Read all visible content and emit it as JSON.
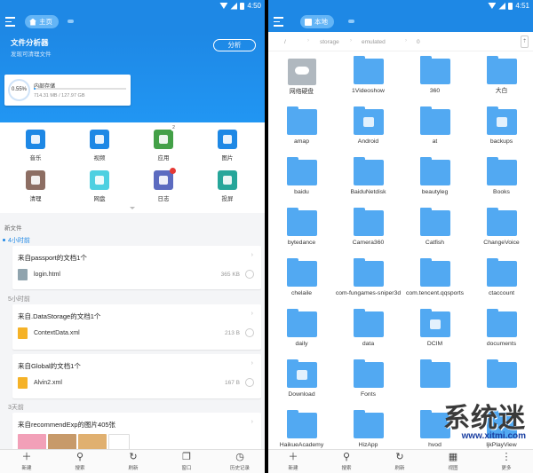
{
  "left": {
    "status": {
      "time": "4:50"
    },
    "toolbar": {
      "tab": "主页"
    },
    "analyzer": {
      "title": "文件分析器",
      "subtitle": "发现可清理文件",
      "analyze_button": "分析"
    },
    "storage": {
      "percent": "0.55%",
      "name": "内部存储",
      "size": "714.31 MB / 127.97 GB",
      "used_fraction": 0.0055
    },
    "categories": [
      {
        "label": "音乐",
        "color": "#1e88e5",
        "icon": "music-icon"
      },
      {
        "label": "视频",
        "color": "#1e88e5",
        "icon": "video-icon"
      },
      {
        "label": "应用",
        "color": "#43a047",
        "icon": "android-icon",
        "badge": "2"
      },
      {
        "label": "图片",
        "color": "#1e88e5",
        "icon": "image-icon"
      },
      {
        "label": "清理",
        "color": "#8d6e63",
        "icon": "broom-icon"
      },
      {
        "label": "网盘",
        "color": "#4dd0e1",
        "icon": "cloud-icon"
      },
      {
        "label": "日志",
        "color": "#5c6bc0",
        "icon": "log-icon",
        "dot": true
      },
      {
        "label": "投屏",
        "color": "#26a69a",
        "icon": "cast-icon"
      }
    ],
    "recent": {
      "header": "新文件",
      "time_labels": [
        "4小时前",
        "5小时前",
        "3天前"
      ],
      "cards": [
        {
          "title": "来自passport的文档1个",
          "file": "login.html",
          "size": "365 KB",
          "type": "html"
        },
        {
          "title": "来自.DataStorage的文档1个",
          "file": "ContextData.xml",
          "size": "213 B",
          "type": "xml"
        },
        {
          "title": "来自Global的文档1个",
          "file": "Alvin2.xml",
          "size": "167 B",
          "type": "xml"
        },
        {
          "title": "来自recommendExp的图片405张"
        }
      ]
    },
    "bottom_nav": [
      {
        "label": "新建",
        "glyph": "＋",
        "icon": "plus-icon"
      },
      {
        "label": "搜索",
        "glyph": "⚲",
        "icon": "search-icon"
      },
      {
        "label": "刷新",
        "glyph": "↻",
        "icon": "refresh-icon"
      },
      {
        "label": "窗口",
        "glyph": "❐",
        "icon": "windows-icon"
      },
      {
        "label": "历史记录",
        "glyph": "◷",
        "icon": "history-icon"
      }
    ]
  },
  "right": {
    "status": {
      "time": "4:51"
    },
    "toolbar": {
      "tab": "本地"
    },
    "path": [
      "/",
      "storage",
      "emulated",
      "0"
    ],
    "items": [
      {
        "label": "网络硬盘",
        "kind": "cloud"
      },
      {
        "label": "1Videoshow"
      },
      {
        "label": "360"
      },
      {
        "label": "大白"
      },
      {
        "label": "amap"
      },
      {
        "label": "Android",
        "glyph": true
      },
      {
        "label": "at"
      },
      {
        "label": "backups",
        "glyph": true
      },
      {
        "label": "baidu"
      },
      {
        "label": "BaiduNetdisk"
      },
      {
        "label": "beautyleg"
      },
      {
        "label": "Books"
      },
      {
        "label": "bytedance"
      },
      {
        "label": "Camera360"
      },
      {
        "label": "Catfish"
      },
      {
        "label": "ChangeVoice"
      },
      {
        "label": "chelaile"
      },
      {
        "label": "com-fungames-sniper3d"
      },
      {
        "label": "com.tencent.qqsports"
      },
      {
        "label": "ctaccount"
      },
      {
        "label": "daily"
      },
      {
        "label": "data"
      },
      {
        "label": "DCIM",
        "glyph": true
      },
      {
        "label": "documents"
      },
      {
        "label": "Download",
        "glyph": true
      },
      {
        "label": "Fonts"
      },
      {
        "label": ""
      },
      {
        "label": ""
      },
      {
        "label": "HaikueAcademy"
      },
      {
        "label": "HizApp"
      },
      {
        "label": "hvod"
      },
      {
        "label": "ljkPlayView"
      }
    ],
    "bottom_nav": [
      {
        "label": "新建",
        "glyph": "＋",
        "icon": "plus-icon"
      },
      {
        "label": "搜索",
        "glyph": "⚲",
        "icon": "search-icon"
      },
      {
        "label": "刷新",
        "glyph": "↻",
        "icon": "refresh-icon"
      },
      {
        "label": "视图",
        "glyph": "▦",
        "icon": "grid-view-icon"
      },
      {
        "label": "",
        "glyph": "",
        "icon": ""
      },
      {
        "label": "更多",
        "glyph": "⋮",
        "icon": "more-icon"
      }
    ]
  },
  "watermark": {
    "text": "系统迷",
    "url": "www.xitmi.com"
  }
}
